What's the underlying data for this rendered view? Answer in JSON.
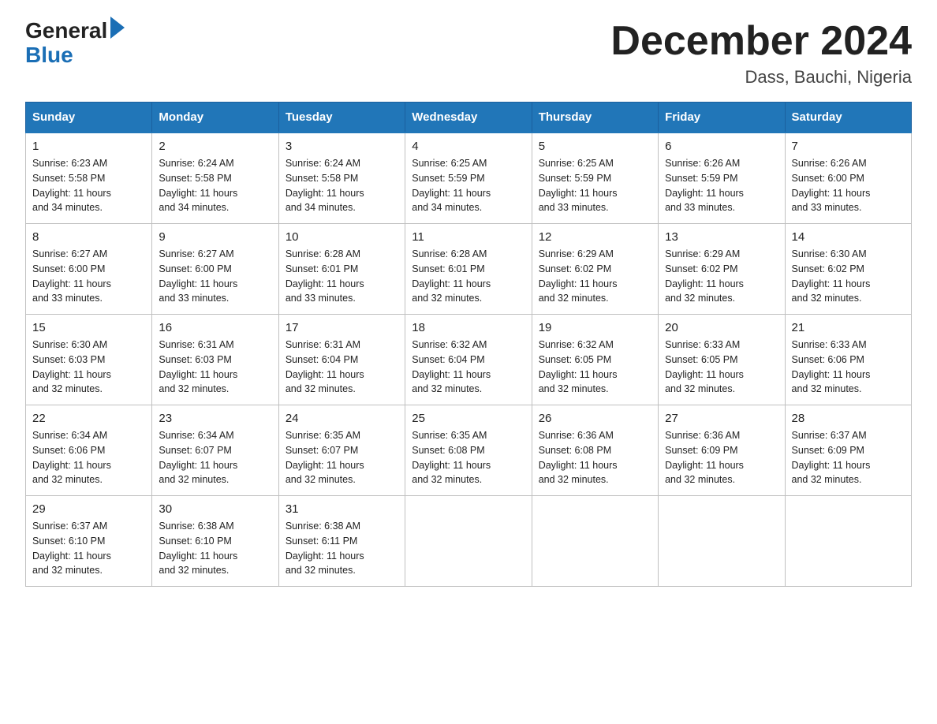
{
  "logo": {
    "general": "General",
    "blue": "Blue"
  },
  "title": "December 2024",
  "location": "Dass, Bauchi, Nigeria",
  "days_of_week": [
    "Sunday",
    "Monday",
    "Tuesday",
    "Wednesday",
    "Thursday",
    "Friday",
    "Saturday"
  ],
  "weeks": [
    [
      {
        "day": "1",
        "sunrise": "6:23 AM",
        "sunset": "5:58 PM",
        "daylight": "11 hours and 34 minutes."
      },
      {
        "day": "2",
        "sunrise": "6:24 AM",
        "sunset": "5:58 PM",
        "daylight": "11 hours and 34 minutes."
      },
      {
        "day": "3",
        "sunrise": "6:24 AM",
        "sunset": "5:58 PM",
        "daylight": "11 hours and 34 minutes."
      },
      {
        "day": "4",
        "sunrise": "6:25 AM",
        "sunset": "5:59 PM",
        "daylight": "11 hours and 34 minutes."
      },
      {
        "day": "5",
        "sunrise": "6:25 AM",
        "sunset": "5:59 PM",
        "daylight": "11 hours and 33 minutes."
      },
      {
        "day": "6",
        "sunrise": "6:26 AM",
        "sunset": "5:59 PM",
        "daylight": "11 hours and 33 minutes."
      },
      {
        "day": "7",
        "sunrise": "6:26 AM",
        "sunset": "6:00 PM",
        "daylight": "11 hours and 33 minutes."
      }
    ],
    [
      {
        "day": "8",
        "sunrise": "6:27 AM",
        "sunset": "6:00 PM",
        "daylight": "11 hours and 33 minutes."
      },
      {
        "day": "9",
        "sunrise": "6:27 AM",
        "sunset": "6:00 PM",
        "daylight": "11 hours and 33 minutes."
      },
      {
        "day": "10",
        "sunrise": "6:28 AM",
        "sunset": "6:01 PM",
        "daylight": "11 hours and 33 minutes."
      },
      {
        "day": "11",
        "sunrise": "6:28 AM",
        "sunset": "6:01 PM",
        "daylight": "11 hours and 32 minutes."
      },
      {
        "day": "12",
        "sunrise": "6:29 AM",
        "sunset": "6:02 PM",
        "daylight": "11 hours and 32 minutes."
      },
      {
        "day": "13",
        "sunrise": "6:29 AM",
        "sunset": "6:02 PM",
        "daylight": "11 hours and 32 minutes."
      },
      {
        "day": "14",
        "sunrise": "6:30 AM",
        "sunset": "6:02 PM",
        "daylight": "11 hours and 32 minutes."
      }
    ],
    [
      {
        "day": "15",
        "sunrise": "6:30 AM",
        "sunset": "6:03 PM",
        "daylight": "11 hours and 32 minutes."
      },
      {
        "day": "16",
        "sunrise": "6:31 AM",
        "sunset": "6:03 PM",
        "daylight": "11 hours and 32 minutes."
      },
      {
        "day": "17",
        "sunrise": "6:31 AM",
        "sunset": "6:04 PM",
        "daylight": "11 hours and 32 minutes."
      },
      {
        "day": "18",
        "sunrise": "6:32 AM",
        "sunset": "6:04 PM",
        "daylight": "11 hours and 32 minutes."
      },
      {
        "day": "19",
        "sunrise": "6:32 AM",
        "sunset": "6:05 PM",
        "daylight": "11 hours and 32 minutes."
      },
      {
        "day": "20",
        "sunrise": "6:33 AM",
        "sunset": "6:05 PM",
        "daylight": "11 hours and 32 minutes."
      },
      {
        "day": "21",
        "sunrise": "6:33 AM",
        "sunset": "6:06 PM",
        "daylight": "11 hours and 32 minutes."
      }
    ],
    [
      {
        "day": "22",
        "sunrise": "6:34 AM",
        "sunset": "6:06 PM",
        "daylight": "11 hours and 32 minutes."
      },
      {
        "day": "23",
        "sunrise": "6:34 AM",
        "sunset": "6:07 PM",
        "daylight": "11 hours and 32 minutes."
      },
      {
        "day": "24",
        "sunrise": "6:35 AM",
        "sunset": "6:07 PM",
        "daylight": "11 hours and 32 minutes."
      },
      {
        "day": "25",
        "sunrise": "6:35 AM",
        "sunset": "6:08 PM",
        "daylight": "11 hours and 32 minutes."
      },
      {
        "day": "26",
        "sunrise": "6:36 AM",
        "sunset": "6:08 PM",
        "daylight": "11 hours and 32 minutes."
      },
      {
        "day": "27",
        "sunrise": "6:36 AM",
        "sunset": "6:09 PM",
        "daylight": "11 hours and 32 minutes."
      },
      {
        "day": "28",
        "sunrise": "6:37 AM",
        "sunset": "6:09 PM",
        "daylight": "11 hours and 32 minutes."
      }
    ],
    [
      {
        "day": "29",
        "sunrise": "6:37 AM",
        "sunset": "6:10 PM",
        "daylight": "11 hours and 32 minutes."
      },
      {
        "day": "30",
        "sunrise": "6:38 AM",
        "sunset": "6:10 PM",
        "daylight": "11 hours and 32 minutes."
      },
      {
        "day": "31",
        "sunrise": "6:38 AM",
        "sunset": "6:11 PM",
        "daylight": "11 hours and 32 minutes."
      },
      null,
      null,
      null,
      null
    ]
  ],
  "labels": {
    "sunrise": "Sunrise:",
    "sunset": "Sunset:",
    "daylight": "Daylight:"
  },
  "colors": {
    "header_bg": "#2176b8",
    "header_text": "#ffffff",
    "border": "#c0c0c0",
    "title_text": "#222222",
    "logo_blue": "#1a6eb5"
  }
}
